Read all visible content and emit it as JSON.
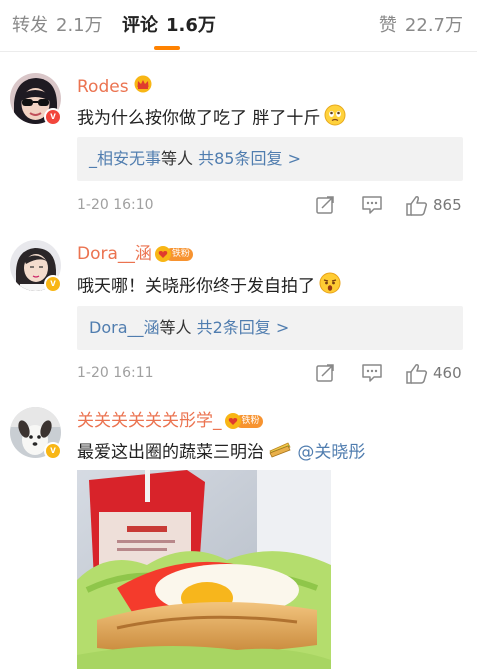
{
  "tabs": {
    "repost": {
      "label": "转发",
      "count": "2.1万"
    },
    "comments": {
      "label": "评论",
      "count": "1.6万"
    },
    "likes": {
      "label": "赞",
      "count": "22.7万"
    },
    "active_color": "#ff8200"
  },
  "comments": [
    {
      "username": "Rodes",
      "verified_badge": "red",
      "text": "我为什么按你做了吃了 胖了十斤",
      "emoji": "sad-face-emoji",
      "replies": {
        "user": "_相安无事",
        "mid": "等人",
        "count_text": "共85条回复 >"
      },
      "time": "1-20 16:10",
      "likes": "865"
    },
    {
      "username": "Dora__涵",
      "verified_badge": "gold",
      "fan_badge": "铁粉",
      "text": "哦天哪！关晓彤你终于发自拍了",
      "emoji": "shocked-face-emoji",
      "replies": {
        "user": "Dora__涵",
        "mid": "等人",
        "count_text": "共2条回复 >"
      },
      "time": "1-20 16:11",
      "likes": "460"
    },
    {
      "username": "关关关关关关彤学_",
      "verified_badge": "gold",
      "fan_badge": "铁粉",
      "text": "最爱这出圈的蔬菜三明治",
      "emoji": "sandwich-emoji",
      "mention": "@关晓彤",
      "image": "sandwich-photo"
    }
  ],
  "colors": {
    "username": "#eb7350",
    "link": "#507daf",
    "meta": "#a0a0a0"
  }
}
